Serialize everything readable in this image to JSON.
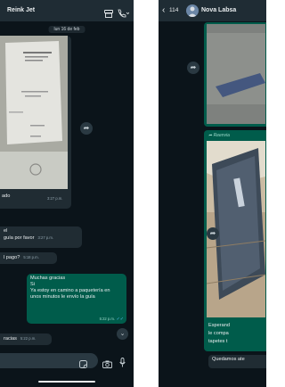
{
  "left_chat": {
    "contact_name": "Reink Jet",
    "date_chip": "lun 16 de feb",
    "image_caption": "ado",
    "image_time": "3:27 p.m.",
    "msg1_line1": "el",
    "msg1_line2": "guía por favor",
    "msg1_time": "3:27 p.m.",
    "msg2_text": "l pago?",
    "msg2_time": "5:18 p.m.",
    "out_line1": "Muchas gracias",
    "out_line2": "Si",
    "out_line3": "Ya estoy en camino a paquetería en",
    "out_line4": "unos minutos le envío la guía",
    "out_time": "5:22 p.m.",
    "msg3_text": "racias",
    "msg3_time": "5:22 p.m."
  },
  "right_chat": {
    "back_count": "114",
    "contact_name": "Nova Labsa",
    "forwarded_label": "Reenvia",
    "caption_line1": "Esperand",
    "caption_line2": "le compa",
    "caption_line3": "tapetes t",
    "last_msg": "Quedamos ate"
  },
  "colors": {
    "chat_bg": "#0b141a",
    "header_bg": "#1f2c34",
    "incoming_bubble": "#202c33",
    "outgoing_bubble": "#005c4b",
    "accent": "#00a884"
  }
}
